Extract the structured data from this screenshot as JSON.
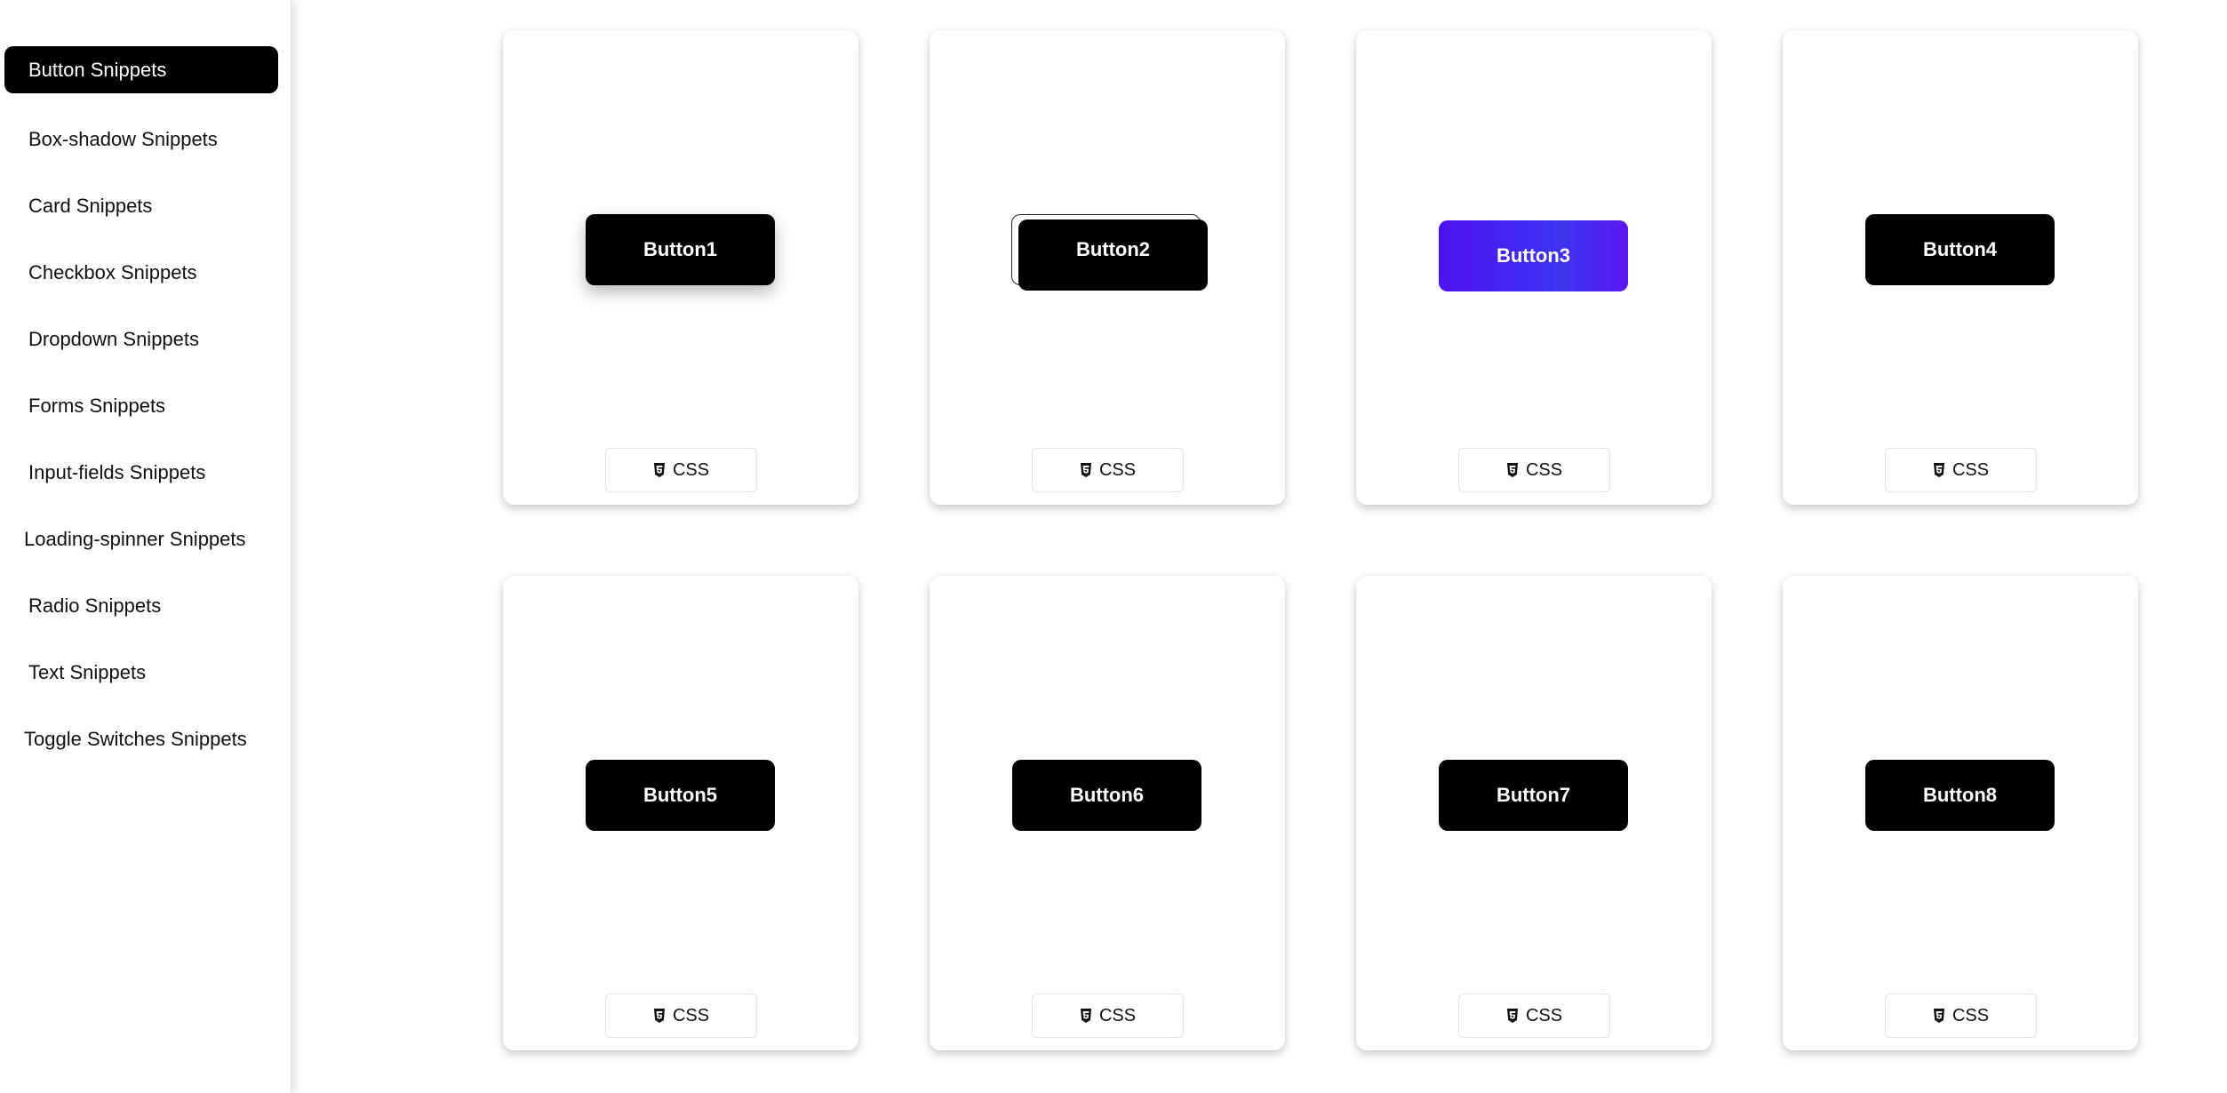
{
  "sidebar": {
    "items": [
      {
        "label": "Button Snippets"
      },
      {
        "label": "Box-shadow Snippets"
      },
      {
        "label": "Card Snippets"
      },
      {
        "label": "Checkbox Snippets"
      },
      {
        "label": "Dropdown Snippets"
      },
      {
        "label": "Forms Snippets"
      },
      {
        "label": "Input-fields Snippets"
      },
      {
        "label": "Loading-spinner Snippets"
      },
      {
        "label": "Radio Snippets"
      },
      {
        "label": "Text Snippets"
      },
      {
        "label": "Toggle Switches Snippets"
      }
    ]
  },
  "cards": [
    {
      "button_label": "Button1",
      "tag_label": "CSS",
      "tag_icon": "css3-icon"
    },
    {
      "button_label": "Button2",
      "tag_label": "CSS",
      "tag_icon": "css3-icon"
    },
    {
      "button_label": "Button3",
      "tag_label": "CSS",
      "tag_icon": "css3-icon"
    },
    {
      "button_label": "Button4",
      "tag_label": "CSS",
      "tag_icon": "css3-icon"
    },
    {
      "button_label": "Button5",
      "tag_label": "CSS",
      "tag_icon": "css3-icon"
    },
    {
      "button_label": "Button6",
      "tag_label": "CSS",
      "tag_icon": "css3-icon"
    },
    {
      "button_label": "Button7",
      "tag_label": "CSS",
      "tag_icon": "css3-icon"
    },
    {
      "button_label": "Button8",
      "tag_label": "CSS",
      "tag_icon": "css3-icon"
    }
  ],
  "colors": {
    "active_nav_bg": "#000000",
    "button_bg": "#000000",
    "button3_gradient_start": "#4d12f0",
    "button3_gradient_end": "#5b16ef"
  }
}
